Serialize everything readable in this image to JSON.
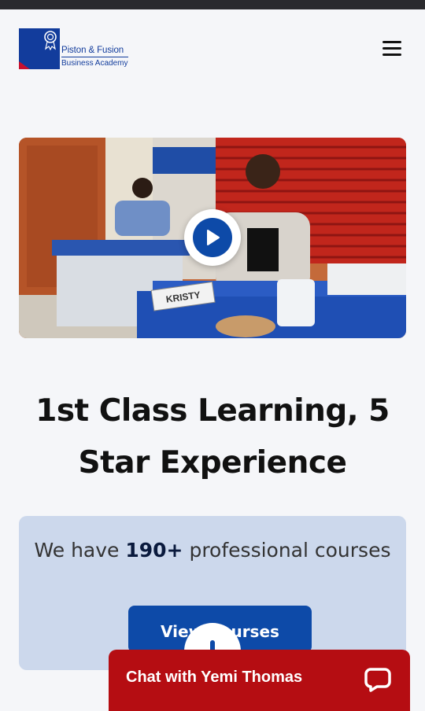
{
  "header": {
    "logo_line1": "Piston & Fusion",
    "logo_line2": "Business Academy",
    "menu_icon": "hamburger-menu-icon"
  },
  "hero": {
    "nameplate": "KRISTY",
    "play_icon": "play-icon"
  },
  "headline": "1st Class Learning, 5 Star Experience",
  "courses": {
    "text_before": "We have ",
    "count": "190+",
    "text_after": " professional courses",
    "button_label": "View Courses"
  },
  "chat": {
    "label": "Chat with Yemi Thomas",
    "icon": "chat-bubble-icon"
  },
  "colors": {
    "brand_blue": "#0d4aa8",
    "chat_red": "#b50d12",
    "card_bg": "#ccd8ec"
  }
}
